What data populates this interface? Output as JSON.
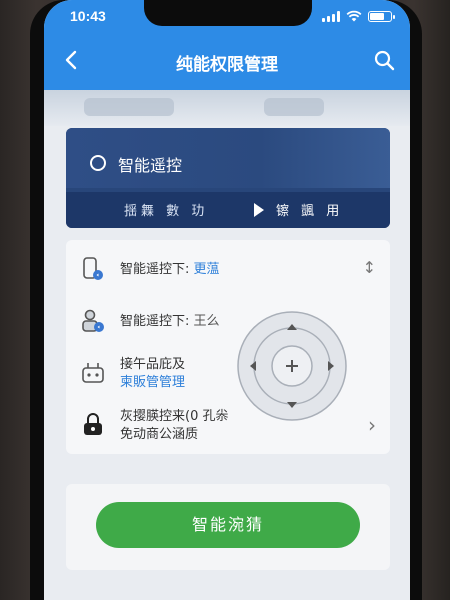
{
  "status_bar": {
    "time": "10:43"
  },
  "nav": {
    "title": "纯能权限管理"
  },
  "feature_card": {
    "title": "智能遥控",
    "sub_left": "揺橆 數 玏",
    "sub_right": "镲 颽 用"
  },
  "list": {
    "rows": [
      {
        "label": "智能遥控下:",
        "value": "更蕰",
        "arrow": "↕"
      },
      {
        "label": "智能遥控下:",
        "value": "王么"
      },
      {
        "line1": "接午品庇及",
        "line2": "柬販管管理"
      },
      {
        "line1": "灰撄朠控来(0 孔尜",
        "line2": "免动商公涵质",
        "arrow": "›"
      }
    ]
  },
  "action": {
    "button_label": "智能涴猜"
  },
  "colors": {
    "header_blue": "#2d8be6",
    "card_navy": "#28467a",
    "link_blue": "#2d7fd9",
    "button_green": "#3faa48"
  },
  "icons": {
    "back": "chevron-left-icon",
    "search": "search-icon",
    "radio": "radio-unchecked-icon",
    "play": "play-icon",
    "dpad": "dpad-icon"
  }
}
